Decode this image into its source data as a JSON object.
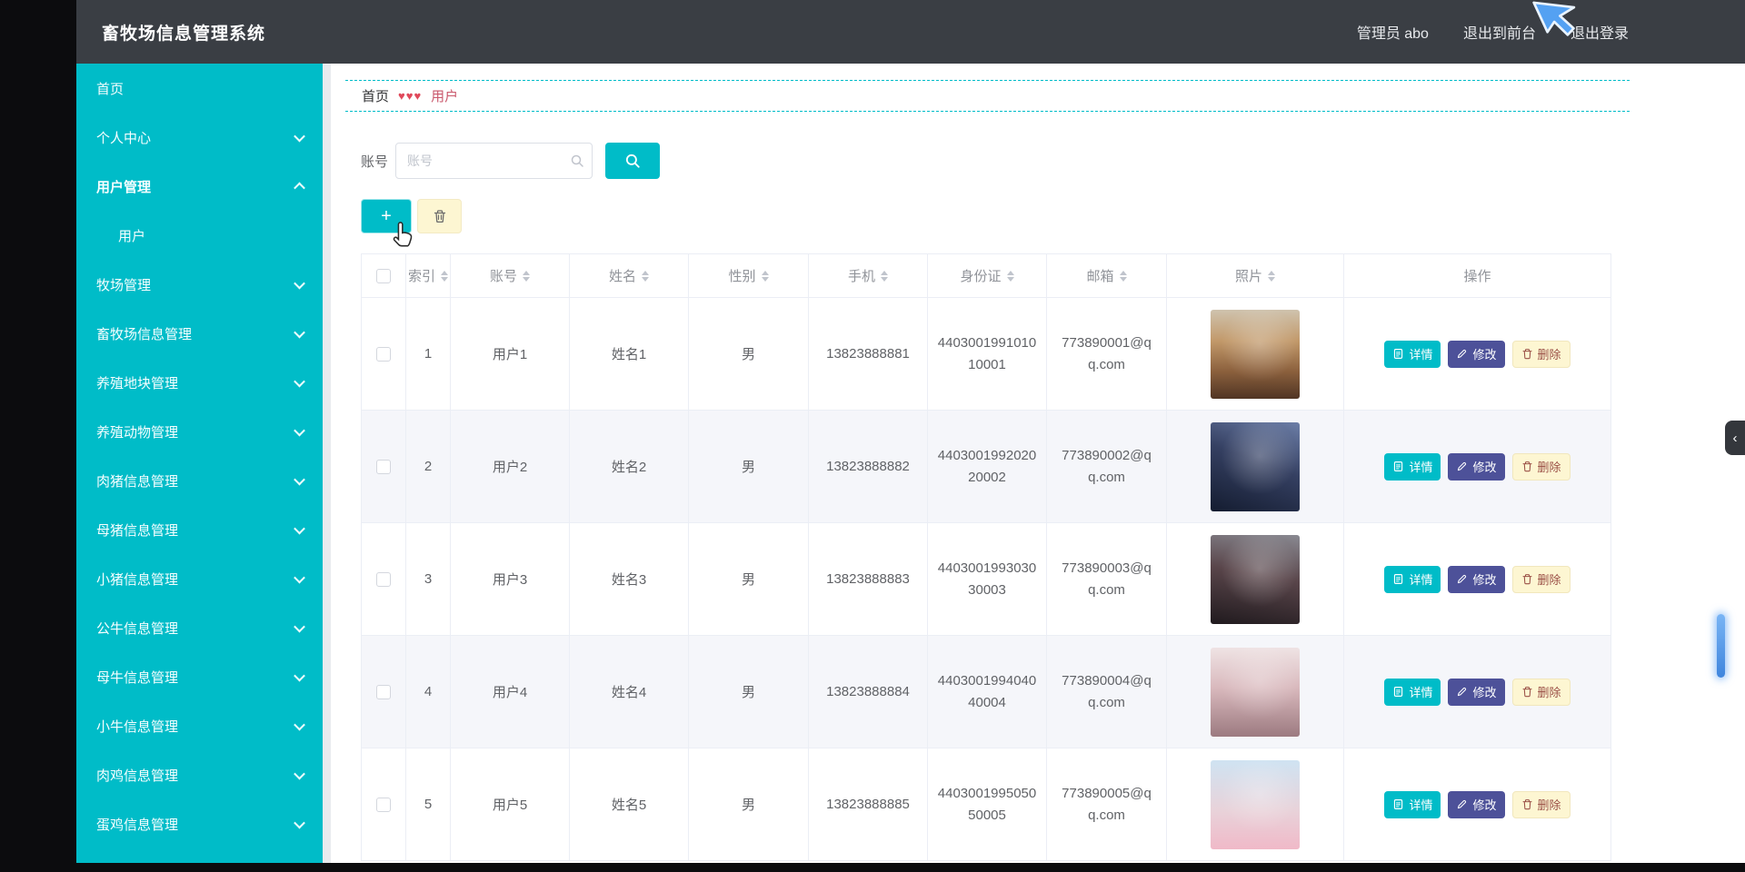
{
  "app": {
    "title": "畜牧场信息管理系统"
  },
  "navbar": {
    "admin": "管理员 abo",
    "exit_front": "退出到前台",
    "logout": "退出登录"
  },
  "sidebar": {
    "items": [
      {
        "label": "首页"
      },
      {
        "label": "个人中心"
      },
      {
        "label": "用户管理"
      },
      {
        "label": "用户"
      },
      {
        "label": "牧场管理"
      },
      {
        "label": "畜牧场信息管理"
      },
      {
        "label": "养殖地块管理"
      },
      {
        "label": "养殖动物管理"
      },
      {
        "label": "肉猪信息管理"
      },
      {
        "label": "母猪信息管理"
      },
      {
        "label": "小猪信息管理"
      },
      {
        "label": "公牛信息管理"
      },
      {
        "label": "母牛信息管理"
      },
      {
        "label": "小牛信息管理"
      },
      {
        "label": "肉鸡信息管理"
      },
      {
        "label": "蛋鸡信息管理"
      }
    ]
  },
  "breadcrumb": {
    "home": "首页",
    "separator": "♥♥♥",
    "current": "用户"
  },
  "search": {
    "label": "账号",
    "placeholder": "账号"
  },
  "toolbar": {
    "add": "+"
  },
  "icons": {
    "collapse_arrow": "‹"
  },
  "table": {
    "headers": [
      "索引",
      "账号",
      "姓名",
      "性别",
      "手机",
      "身份证",
      "邮箱",
      "照片",
      "操作"
    ],
    "rows": [
      {
        "index": "1",
        "account": "用户1",
        "name": "姓名1",
        "gender": "男",
        "phone": "13823888881",
        "idcard": "440300199101010001",
        "email": "773890001@qq.com"
      },
      {
        "index": "2",
        "account": "用户2",
        "name": "姓名2",
        "gender": "男",
        "phone": "13823888882",
        "idcard": "440300199202020002",
        "email": "773890002@qq.com"
      },
      {
        "index": "3",
        "account": "用户3",
        "name": "姓名3",
        "gender": "男",
        "phone": "13823888883",
        "idcard": "440300199303030003",
        "email": "773890003@qq.com"
      },
      {
        "index": "4",
        "account": "用户4",
        "name": "姓名4",
        "gender": "男",
        "phone": "13823888884",
        "idcard": "440300199404040004",
        "email": "773890004@qq.com"
      },
      {
        "index": "5",
        "account": "用户5",
        "name": "姓名5",
        "gender": "男",
        "phone": "13823888885",
        "idcard": "440300199505050005",
        "email": "773890005@qq.com"
      }
    ]
  },
  "row_actions": {
    "detail": "详情",
    "edit": "修改",
    "delete": "删除"
  },
  "colors": {
    "accent": "#00bcc8",
    "navbar_bg": "#3a3e44",
    "edit_button": "#4d5199",
    "delete_button_bg": "#fdf6d2",
    "breadcrumb_red": "#e0485a",
    "row_alt_bg": "#f5f6fa"
  }
}
